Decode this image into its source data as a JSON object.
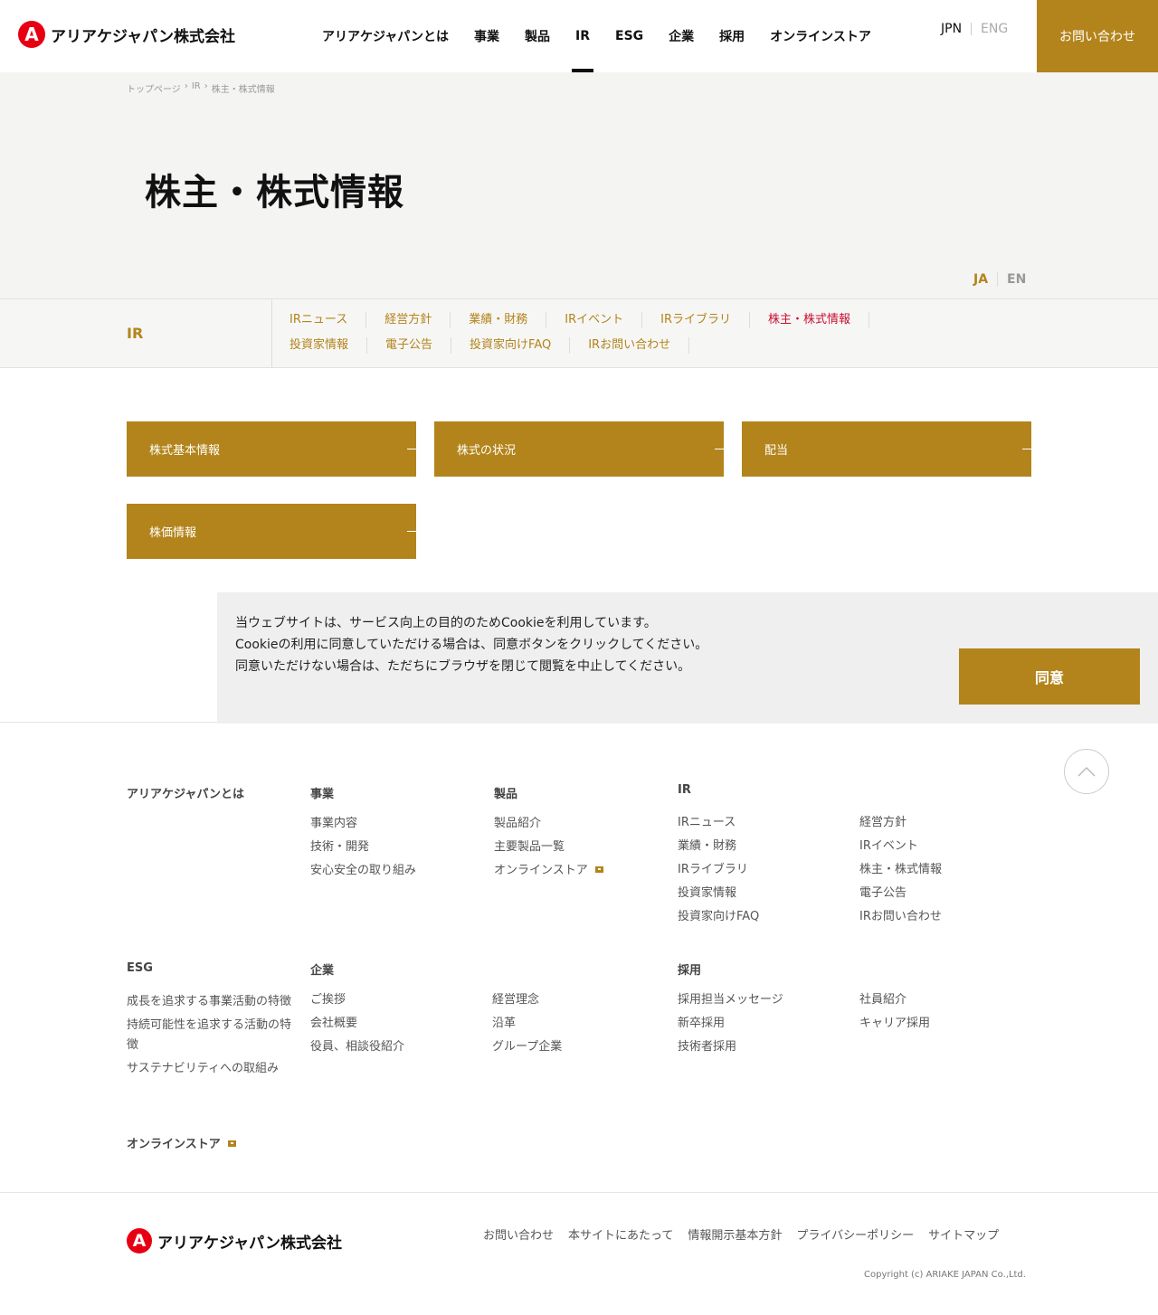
{
  "header": {
    "logo_mark": "A",
    "logo_text": "アリアケジャパン株式会社",
    "nav": [
      "アリアケジャパンとは",
      "事業",
      "製品",
      "IR",
      "ESG",
      "企業",
      "採用",
      "オンラインストア"
    ],
    "lang_on": "JPN",
    "lang_off": "ENG",
    "contact": "お問い合わせ"
  },
  "hero": {
    "breadcrumb": [
      "トップページ",
      "›",
      "IR",
      "›",
      "株主・株式情報"
    ],
    "title": "株主・株式情報",
    "lang_on": "JA",
    "lang_off": "EN"
  },
  "localnav": {
    "title": "IR",
    "links": [
      "IRニュース",
      "経営方針",
      "業績・財務",
      "IRイベント",
      "IRライブラリ",
      "株主・株式情報",
      "投資家情報",
      "電子公告",
      "投資家向けFAQ",
      "IRお問い合わせ"
    ]
  },
  "cards": [
    "株式基本情報",
    "株式の状況",
    "配当",
    "株価情報"
  ],
  "cookie": {
    "line1": "当ウェブサイトは、サービス向上の目的のためCookieを利用しています。",
    "line2": "Cookieの利用に同意していただける場合は、同意ボタンをクリックしてください。",
    "line3": "同意いただけない場合は、ただちにブラウザを閉じて閲覧を中止してください。",
    "button": "同意"
  },
  "footer": {
    "about": "アリアケジャパンとは",
    "business": {
      "title": "事業",
      "items": [
        "事業内容",
        "技術・開発",
        "安心安全の取り組み"
      ]
    },
    "products": {
      "title": "製品",
      "items": [
        "製品紹介",
        "主要製品一覧",
        "オンラインストア"
      ]
    },
    "ir": {
      "title": "IR",
      "col1": [
        "IRニュース",
        "業績・財務",
        "IRライブラリ",
        "投資家情報",
        "投資家向けFAQ"
      ],
      "col2": [
        "経営方針",
        "IRイベント",
        "株主・株式情報",
        "電子公告",
        "IRお問い合わせ"
      ]
    },
    "esg": {
      "title": "ESG",
      "items": [
        "成長を追求する事業活動の特徴",
        "持続可能性を追求する活動の特徴",
        "サステナビリティへの取組み"
      ]
    },
    "company": {
      "title": "企業",
      "col1": [
        "ご挨拶",
        "会社概要",
        "役員、相談役紹介"
      ],
      "col2": [
        "経営理念",
        "沿革",
        "グループ企業"
      ]
    },
    "recruit": {
      "title": "採用",
      "col1": [
        "採用担当メッセージ",
        "新卒採用",
        "技術者採用"
      ],
      "col2": [
        "社員紹介",
        "キャリア採用"
      ]
    },
    "store": "オンラインストア",
    "links": [
      "お問い合わせ",
      "本サイトにあたって",
      "情報開示基本方針",
      "プライバシーポリシー",
      "サイトマップ"
    ],
    "copyright": "Copyright (c) ARIAKE JAPAN Co.,Ltd."
  },
  "colors": {
    "accent": "#b3841b",
    "current": "#c8102e",
    "logo_red": "#e60012"
  },
  "icons": {
    "page_top": "chevron-up-icon",
    "external": "external-link-icon"
  }
}
